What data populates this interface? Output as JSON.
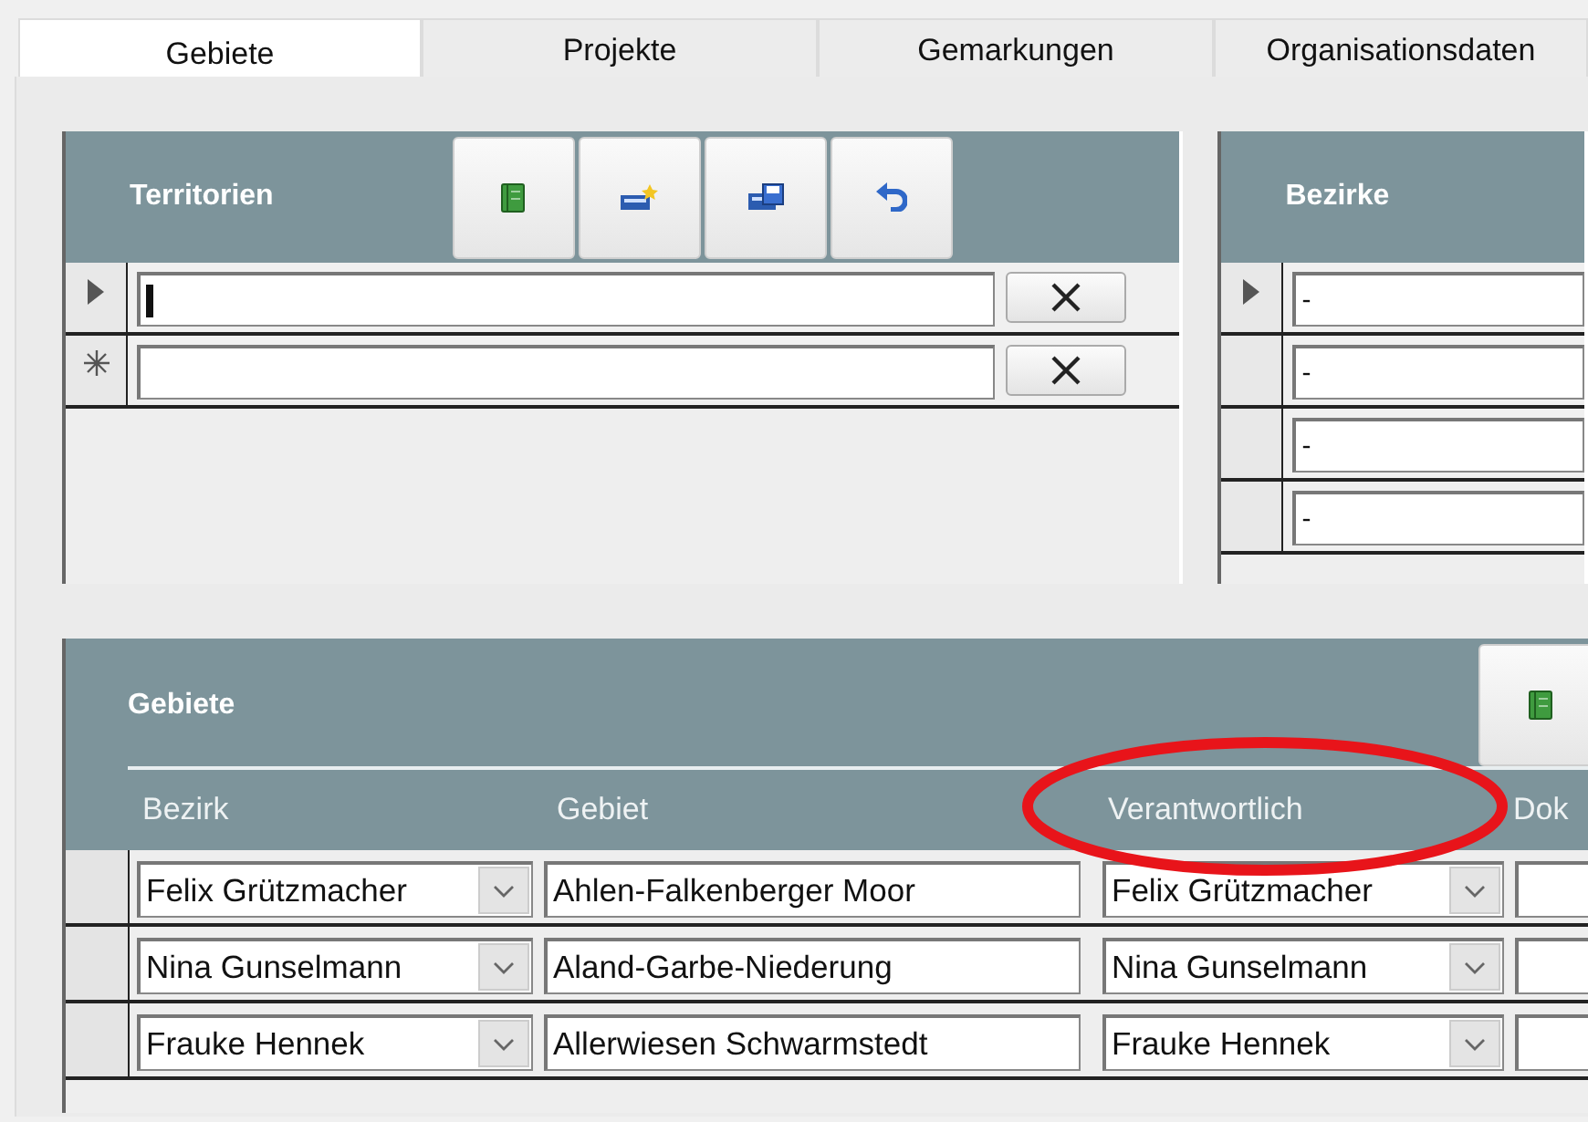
{
  "tabs": [
    {
      "label": "Gebiete",
      "selected": true
    },
    {
      "label": "Projekte",
      "selected": false
    },
    {
      "label": "Gemarkungen",
      "selected": false
    },
    {
      "label": "Organisationsdaten",
      "selected": false
    }
  ],
  "territorien": {
    "title": "Territorien",
    "rows": [
      {
        "current": true,
        "new_row": false,
        "focused": true
      },
      {
        "current": false,
        "new_row": true,
        "focused": false
      }
    ]
  },
  "bezirke": {
    "title": "Bezirke",
    "rows": [
      {
        "current": true,
        "value": "-"
      },
      {
        "current": false,
        "value": "-"
      },
      {
        "current": false,
        "value": "-"
      },
      {
        "current": false,
        "value": "-"
      }
    ]
  },
  "gebiete": {
    "title": "Gebiete",
    "columns": [
      {
        "label": "Bezirk",
        "circled": false
      },
      {
        "label": "Gebiet",
        "circled": false
      },
      {
        "label": "Verantwortlich",
        "circled": true
      },
      {
        "label": "Dok",
        "circled": false
      }
    ],
    "rows": [
      {
        "bezirk": "Felix Grützmacher",
        "gebiet": "Ahlen-Falkenberger Moor",
        "verantwortlich": "Felix Grützmacher"
      },
      {
        "bezirk": "Nina Gunselmann",
        "gebiet": "Aland-Garbe-Niederung",
        "verantwortlich": "Nina Gunselmann"
      },
      {
        "bezirk": "Frauke Hennek",
        "gebiet": "Allerwiesen Schwarmstedt",
        "verantwortlich": "Frauke Hennek"
      }
    ]
  }
}
